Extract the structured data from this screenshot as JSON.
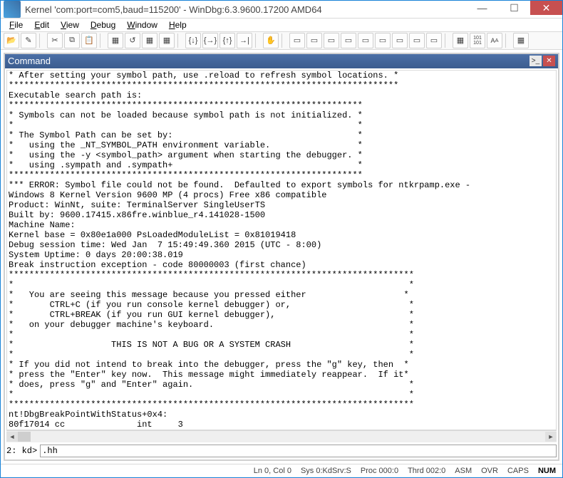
{
  "title": "Kernel 'com:port=com5,baud=115200' - WinDbg:6.3.9600.17200 AMD64",
  "menus": [
    "File",
    "Edit",
    "View",
    "Debug",
    "Window",
    "Help"
  ],
  "panel_title": "Command",
  "output": "* After setting your symbol path, use .reload to refresh symbol locations. *\n****************************************************************************\nExecutable search path is: \n*********************************************************************\n* Symbols can not be loaded because symbol path is not initialized. *\n*                                                                   *\n* The Symbol Path can be set by:                                    *\n*   using the _NT_SYMBOL_PATH environment variable.                 *\n*   using the -y <symbol_path> argument when starting the debugger. *\n*   using .sympath and .sympath+                                    *\n*********************************************************************\n*** ERROR: Symbol file could not be found.  Defaulted to export symbols for ntkrpamp.exe - \nWindows 8 Kernel Version 9600 MP (4 procs) Free x86 compatible\nProduct: WinNt, suite: TerminalServer SingleUserTS\nBuilt by: 9600.17415.x86fre.winblue_r4.141028-1500\nMachine Name:\nKernel base = 0x80e1a000 PsLoadedModuleList = 0x81019418\nDebug session time: Wed Jan  7 15:49:49.360 2015 (UTC - 8:00)\nSystem Uptime: 0 days 20:00:38.019\nBreak instruction exception - code 80000003 (first chance)\n*******************************************************************************\n*                                                                             *\n*   You are seeing this message because you pressed either                   *\n*       CTRL+C (if you run console kernel debugger) or,                       *\n*       CTRL+BREAK (if you run GUI kernel debugger),                          *\n*   on your debugger machine's keyboard.                                      *\n*                                                                             *\n*                   THIS IS NOT A BUG OR A SYSTEM CRASH                       *\n*                                                                             *\n* If you did not intend to break into the debugger, press the \"g\" key, then  *\n* press the \"Enter\" key now.  This message might immediately reappear.  If it*\n* does, press \"g\" and \"Enter\" again.                                          *\n*                                                                             *\n*******************************************************************************\nnt!DbgBreakPointWithStatus+0x4:\n80f17014 cc              int     3",
  "prompt": "2: kd>",
  "prompt_value": ".hh",
  "status": {
    "lncol": "Ln 0, Col 0",
    "sys": "Sys 0:KdSrv:S",
    "proc": "Proc 000:0",
    "thrd": "Thrd 002:0",
    "asm": "ASM",
    "ovr": "OVR",
    "caps": "CAPS",
    "num": "NUM"
  },
  "toolbar_icons": [
    "open",
    "save-workspace",
    "sep",
    "cut",
    "copy",
    "paste",
    "sep",
    "go",
    "restart",
    "stop",
    "break",
    "sep",
    "step-into",
    "step-over",
    "step-out",
    "run-to-cursor",
    "sep",
    "source-mode",
    "sep",
    "breakpoint",
    "command",
    "watch",
    "locals",
    "registers",
    "memory",
    "calls",
    "disasm",
    "scratch",
    "processes",
    "sep",
    "font",
    "options",
    "sep",
    "a-font",
    "101",
    "sep",
    "help"
  ]
}
